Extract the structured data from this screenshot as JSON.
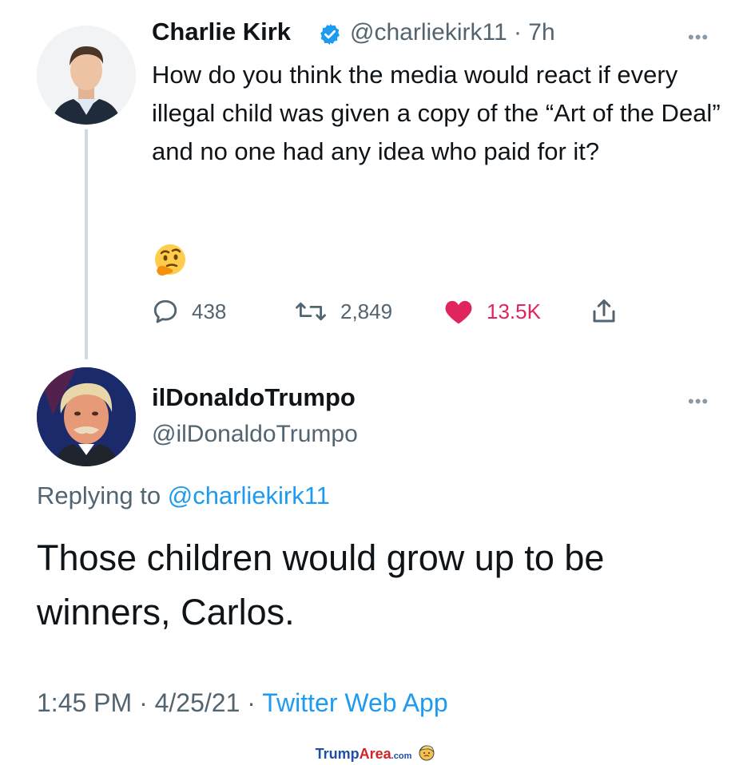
{
  "parent": {
    "name": "Charlie Kirk",
    "handle": "@charliekirk11",
    "time": "· 7h",
    "more": "•••",
    "text": "How do you think the media would react if every illegal child was given a copy of the “Art of the Deal” and no one had any idea who paid for it?",
    "emoji": "thinking-face",
    "actions": {
      "replies": "438",
      "retweets": "2,849",
      "likes": "13.5K"
    }
  },
  "reply": {
    "name": "ilDonaldoTrumpo",
    "handle": "@ilDonaldoTrumpo",
    "more": "•••",
    "replying_prefix": "Replying to ",
    "replying_to": "@charliekirk11",
    "text": "Those children would grow up to be winners, Carlos.",
    "timestamp": "1:45 PM · 4/25/21 · ",
    "source": "Twitter Web App"
  },
  "watermark": {
    "part1": "Trump",
    "part2": "Area",
    "part3": ".com"
  },
  "colors": {
    "accent": "#1d9bf0",
    "like": "#e0245e",
    "muted": "#536471"
  }
}
